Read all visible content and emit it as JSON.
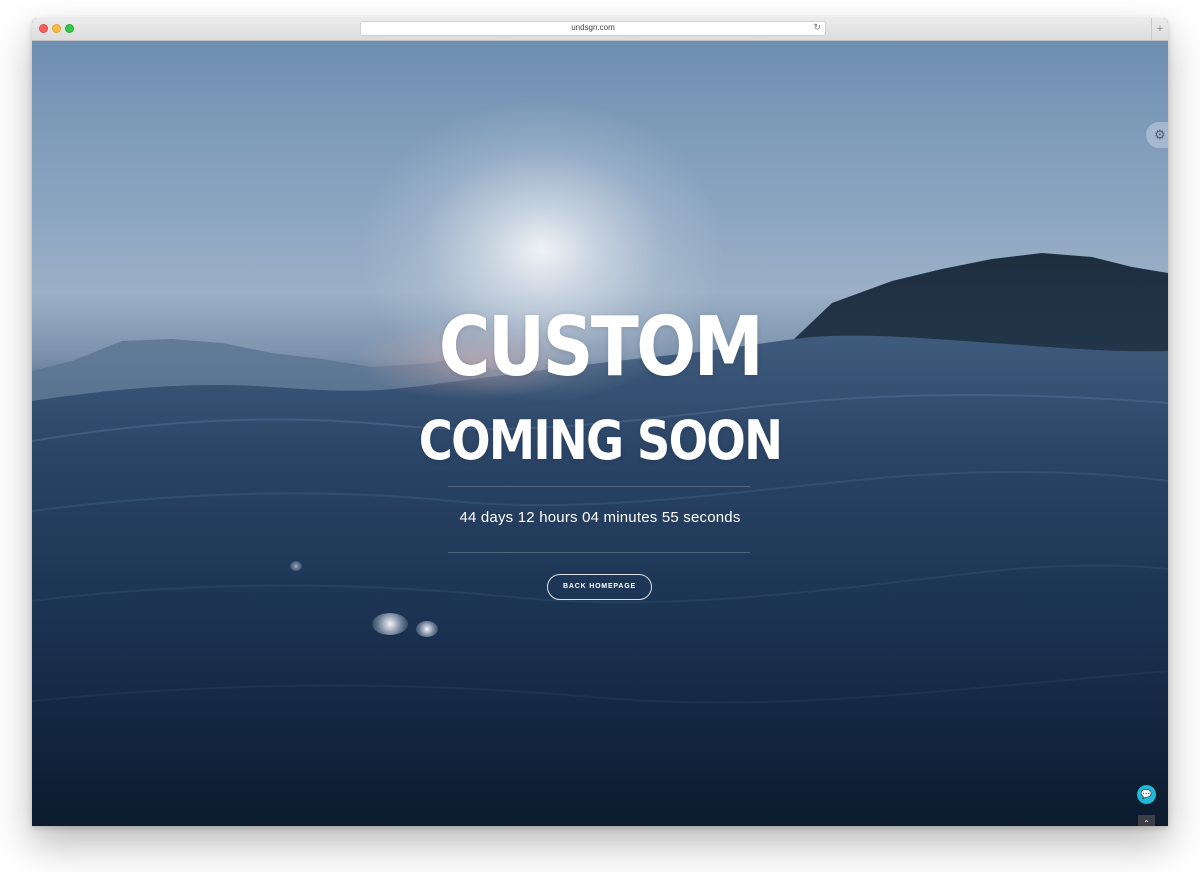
{
  "browser": {
    "url": "undsgn.com",
    "reload_glyph": "↻",
    "newtab_glyph": "+"
  },
  "hero": {
    "title_line_1": "CUSTOM",
    "title_line_2": "COMING SOON",
    "countdown": "44 days 12 hours 04 minutes 55 seconds",
    "cta_label": "BACK HOMEPAGE"
  },
  "icons": {
    "gear": "gear-icon",
    "chat": "chat-icon",
    "back_to_top": "chevron-up-icon",
    "gear_glyph": "⚙",
    "chat_glyph": "💬",
    "totop_glyph": "⌃"
  },
  "colors": {
    "accent_chat": "#1fb8d6",
    "totop_bg": "#3b3f45",
    "text": "#ffffff"
  }
}
